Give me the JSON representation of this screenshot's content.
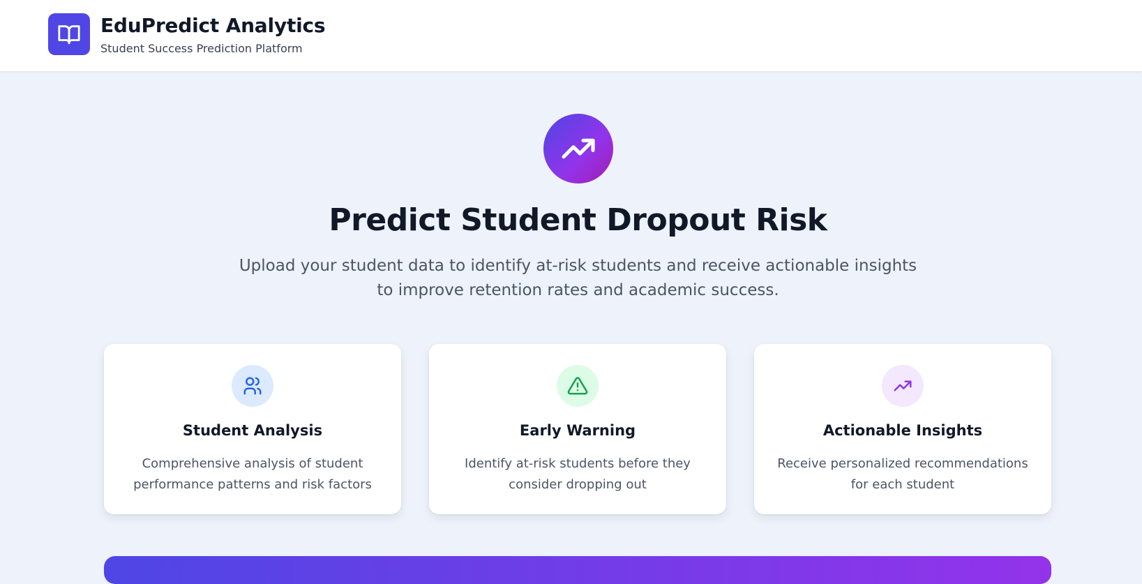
{
  "header": {
    "logo_icon": "open-book-icon",
    "title": "EduPredict Analytics",
    "subtitle": "Student Success Prediction Platform"
  },
  "hero": {
    "icon": "trending-up-icon",
    "title": "Predict Student Dropout Risk",
    "description": "Upload your student data to identify at-risk students and receive actionable insights to improve retention rates and academic success."
  },
  "features": [
    {
      "icon": "users-icon",
      "title": "Student Analysis",
      "description": "Comprehensive analysis of student performance patterns and risk factors",
      "icon_color": "#2563eb",
      "icon_bg": "#dbeafe"
    },
    {
      "icon": "warning-triangle-icon",
      "title": "Early Warning",
      "description": "Identify at-risk students before they consider dropping out",
      "icon_color": "#16a34a",
      "icon_bg": "#dcfce7"
    },
    {
      "icon": "trending-up-icon",
      "title": "Actionable Insights",
      "description": "Receive personalized recommendations for each student",
      "icon_color": "#9333ea",
      "icon_bg": "#f3e8ff"
    }
  ],
  "colors": {
    "brand": "#4f46e5",
    "accent": "#9333ea",
    "page_bg": "#eef2fb"
  }
}
